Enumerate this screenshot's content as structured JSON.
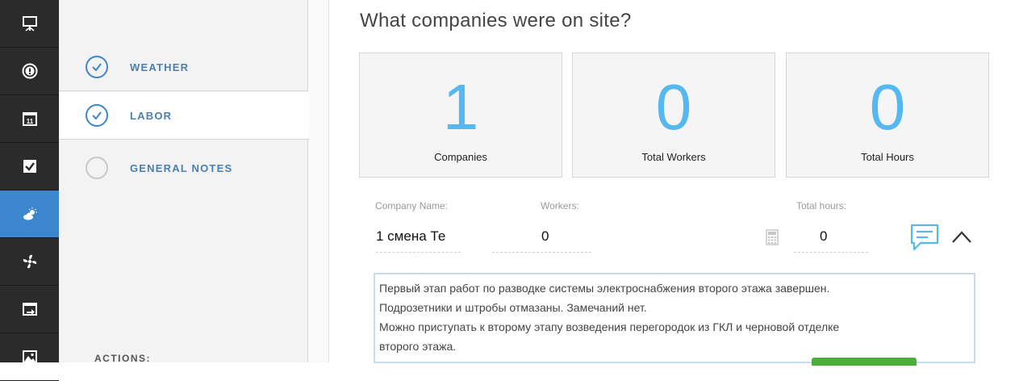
{
  "rail": {
    "items": [
      {
        "icon": "presentation-icon",
        "active": false
      },
      {
        "icon": "alert-icon",
        "active": false
      },
      {
        "icon": "calendar-icon",
        "active": false,
        "text": "11"
      },
      {
        "icon": "checkbox-icon",
        "active": false
      },
      {
        "icon": "weather-icon",
        "active": true
      },
      {
        "icon": "fan-icon",
        "active": false
      },
      {
        "icon": "export-icon",
        "active": false
      },
      {
        "icon": "image-icon",
        "active": false
      }
    ],
    "active_color": "#3b86cd"
  },
  "steps": {
    "items": [
      {
        "label": "WEATHER",
        "done": true
      },
      {
        "label": "LABOR",
        "done": true
      },
      {
        "label": "GENERAL NOTES",
        "done": false
      }
    ],
    "actions_label": "ACTIONS:"
  },
  "main": {
    "heading": "What companies were on site?",
    "stats": [
      {
        "value": "1",
        "caption": "Companies"
      },
      {
        "value": "0",
        "caption": "Total Workers"
      },
      {
        "value": "0",
        "caption": "Total Hours"
      }
    ],
    "columns": {
      "company": "Company Name:",
      "workers": "Workers:",
      "hours": "Total hours:"
    },
    "row": {
      "company": "1 смена Те",
      "workers": "0",
      "hours": "0"
    },
    "notes": [
      "Первый этап работ по разводке системы электроснабжения второго этажа завершен.",
      "Подрозетники и штробы отмазаны. Замечаний нет.",
      "Можно приступать к второму этапу возведения перегородок из ГКЛ и черновой отделке",
      "второго этажа."
    ],
    "accent": "#55b8f0"
  }
}
